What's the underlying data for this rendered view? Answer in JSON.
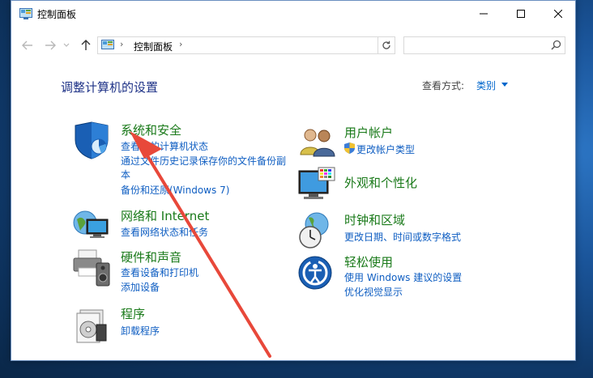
{
  "window": {
    "title": "控制面板"
  },
  "address": {
    "sep1": "›",
    "crumb": "控制面板",
    "sep2": "›"
  },
  "search": {
    "placeholder": "",
    "value": ""
  },
  "main": {
    "heading": "调整计算机的设置",
    "view_by_label": "查看方式:",
    "view_by_value": "类别"
  },
  "categories": {
    "system": {
      "title": "系统和安全",
      "links": [
        "查看你的计算机状态",
        "通过文件历史记录保存你的文件备份副",
        "本",
        "备份和还原(Windows 7)"
      ]
    },
    "network": {
      "title": "网络和 Internet",
      "links": [
        "查看网络状态和任务"
      ]
    },
    "hardware": {
      "title": "硬件和声音",
      "links": [
        "查看设备和打印机",
        "添加设备"
      ]
    },
    "programs": {
      "title": "程序",
      "links": [
        "卸载程序"
      ]
    },
    "users": {
      "title": "用户帐户",
      "links": [
        "更改帐户类型"
      ]
    },
    "appearance": {
      "title": "外观和个性化",
      "links": []
    },
    "clock": {
      "title": "时钟和区域",
      "links": [
        "更改日期、时间或数字格式"
      ]
    },
    "ease": {
      "title": "轻松使用",
      "links": [
        "使用 Windows 建议的设置",
        "优化视觉显示"
      ]
    }
  },
  "colors": {
    "heading": "#1e3287",
    "category_title": "#1a7a1a",
    "link": "#0f5ec2",
    "annotation_arrow": "#e8483a"
  }
}
